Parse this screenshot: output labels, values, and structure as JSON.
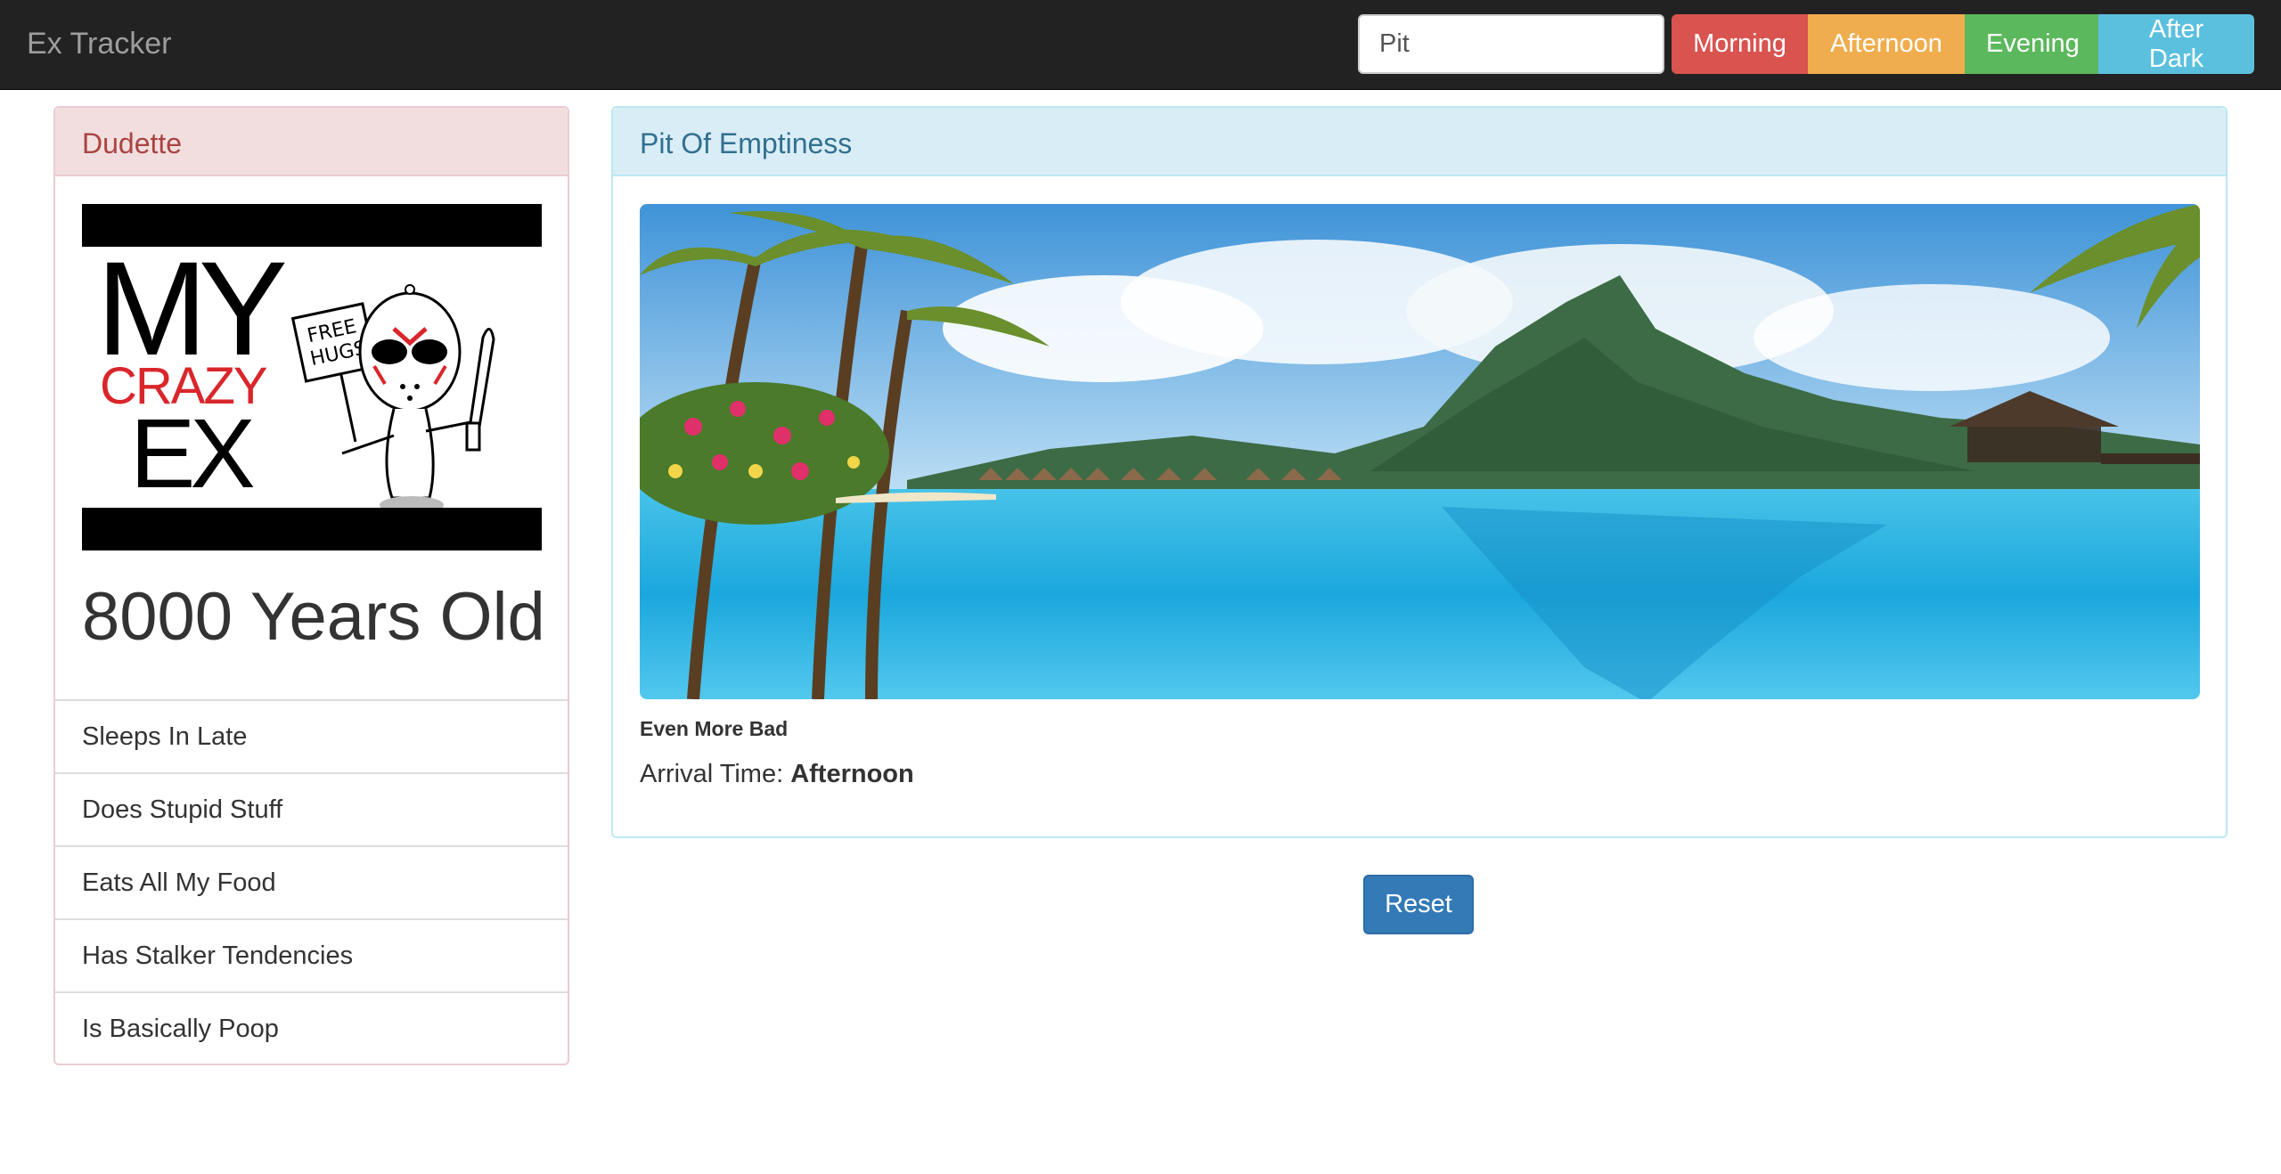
{
  "navbar": {
    "brand": "Ex Tracker",
    "search_value": "Pit",
    "buttons": {
      "morning": "Morning",
      "afternoon": "Afternoon",
      "evening": "Evening",
      "after_dark": "After Dark"
    },
    "colors": {
      "morning": "#d9534f",
      "afternoon": "#f0ad4e",
      "evening": "#5cb85c",
      "after_dark": "#5bc0de"
    }
  },
  "profile": {
    "name": "Dudette",
    "logo": {
      "line1": "MY",
      "line2": "CRAZY",
      "line3": "EX",
      "sign": "FREE HUGS"
    },
    "age": "8000 Years Old",
    "traits": [
      "Sleeps In Late",
      "Does Stupid Stuff",
      "Eats All My Food",
      "Has Stalker Tendencies",
      "Is Basically Poop"
    ]
  },
  "location": {
    "title": "Pit Of Emptiness",
    "photo": "tropical-infinity-pool-image",
    "caption": "Even More Bad",
    "arrival_label": "Arrival Time:",
    "arrival_value": "Afternoon"
  },
  "actions": {
    "reset_label": "Reset"
  }
}
